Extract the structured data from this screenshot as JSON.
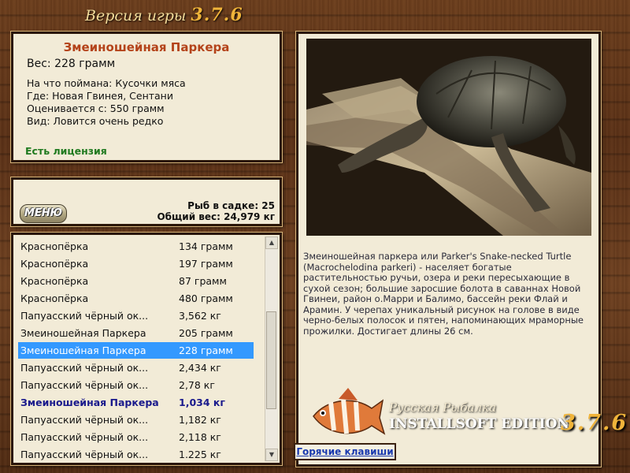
{
  "header": {
    "title_text": "Версия игры",
    "version": "3.7.6"
  },
  "info": {
    "fish_name": "Змеиношейная Паркера",
    "weight": "Вес: 228 грамм",
    "caught_on": "На что поймана: Кусочки мяса",
    "location": "Где: Новая Гвинея, Сентани",
    "valued_from": "Оценивается с: 550 грамм",
    "kind": "Вид: Ловится очень редко",
    "license": "Есть лицензия"
  },
  "menu": {
    "button_label": "МЕНЮ",
    "fish_in_cage": "Рыб в садке: 25",
    "total_weight": "Общий вес: 24,979 кг"
  },
  "catch_list": [
    {
      "name": "Краснопёрка",
      "weight": "134 грамм"
    },
    {
      "name": "Краснопёрка",
      "weight": "197 грамм"
    },
    {
      "name": "Краснопёрка",
      "weight": "87 грамм"
    },
    {
      "name": "Краснопёрка",
      "weight": "480 грамм"
    },
    {
      "name": "Папуасский чёрный ок...",
      "weight": "3,562 кг"
    },
    {
      "name": "Змеиношейная Паркера",
      "weight": "205 грамм"
    },
    {
      "name": "Змеиношейная Паркера",
      "weight": "228 грамм"
    },
    {
      "name": "Папуасский чёрный ок...",
      "weight": "2,434 кг"
    },
    {
      "name": "Папуасский чёрный ок...",
      "weight": "2,78 кг"
    },
    {
      "name": "Змеиношейная Паркера",
      "weight": "1,034 кг"
    },
    {
      "name": "Папуасский чёрный ок...",
      "weight": "1,182 кг"
    },
    {
      "name": "Папуасский чёрный ок...",
      "weight": "2,118 кг"
    },
    {
      "name": "Папуасский чёрный ок...",
      "weight": "1.225 кг"
    }
  ],
  "selected_index": 6,
  "bold_index": 9,
  "description": "Змеиношейная паркера или Parker's Snake-necked Turtle (Macrochelodina parkeri) - населяет богатые растительностью ручьи, озера и реки пересыхающие в сухой сезон; большие заросшие болота в саваннах Новой Гвинеи, район о.Марри и Балимо, бассейн реки Флай и Арамин. У черепах уникальный рисунок на голове в виде черно-белых полосок и пятен, напоминающих мраморные прожилки. Достигает длины 26 см.",
  "logo": {
    "subtitle": "Русская Рыбалка",
    "edition": "INSTALLSOFT EDITION",
    "version": "3.7.6"
  },
  "hotkeys_label": "Горячие клавиши",
  "icons": {
    "scroll_up": "chevron-up-icon",
    "scroll_down": "chevron-down-icon"
  },
  "colors": {
    "selection": "#3399ff",
    "fish_name": "#b4431a",
    "license": "#1f7a1f",
    "version_gold": "#f0b43a"
  }
}
